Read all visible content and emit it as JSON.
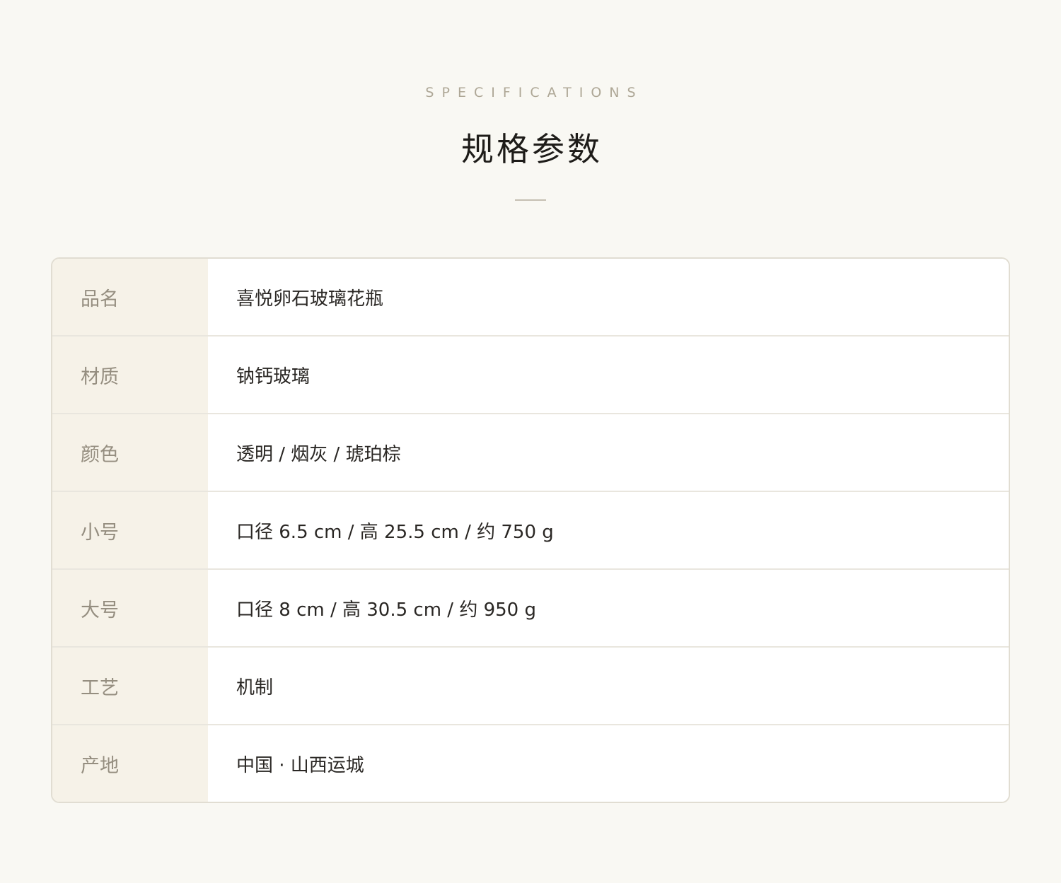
{
  "header": {
    "eyebrow": "SPECIFICATIONS",
    "title": "规格参数"
  },
  "specs": [
    {
      "label": "品名",
      "value": "喜悦卵石玻璃花瓶"
    },
    {
      "label": "材质",
      "value": "钠钙玻璃"
    },
    {
      "label": "颜色",
      "value": "透明 / 烟灰 / 琥珀棕"
    },
    {
      "label": "小号",
      "value": "口径 6.5 cm / 高 25.5 cm / 约 750 g"
    },
    {
      "label": "大号",
      "value": "口径 8 cm / 高 30.5 cm / 约 950 g"
    },
    {
      "label": "工艺",
      "value": "机制"
    },
    {
      "label": "产地",
      "value": "中国 · 山西运城"
    }
  ],
  "colors": {
    "background": "#f9f8f3",
    "label_bg": "#f6f2e8",
    "label_text": "#958e80",
    "value_text": "#2a2724",
    "title_text": "#1e1c19",
    "eyebrow_text": "#aea796",
    "border": "#e1ddd2"
  }
}
